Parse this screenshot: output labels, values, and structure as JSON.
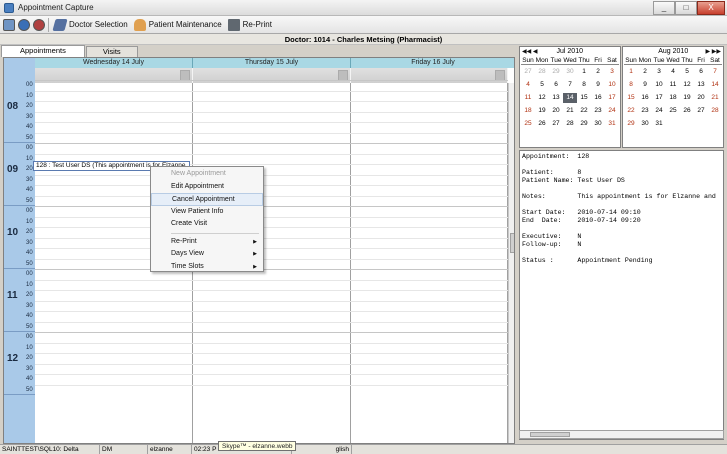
{
  "window": {
    "title": "Appointment Capture",
    "controls": [
      "_",
      "□",
      "X"
    ]
  },
  "toolbar": {
    "doctor_selection": "Doctor Selection",
    "patient_maintenance": "Patient Maintenance",
    "reprint": "Re-Print"
  },
  "header": {
    "title": "Doctor: 1014 - Charles Metsing (Pharmacist)"
  },
  "tabs": [
    {
      "label": "Appointments"
    },
    {
      "label": "Visits"
    }
  ],
  "calendar": {
    "days": [
      "Wednesday 14 July",
      "Thursday 15 July",
      "Friday 16 July"
    ],
    "hours": [
      "08",
      "09",
      "10",
      "11",
      "12"
    ],
    "minutes": [
      "00",
      "10",
      "20",
      "30",
      "40",
      "50"
    ]
  },
  "appointment": {
    "label": "128 : Test User DS (This appointment is for Elzanne"
  },
  "context_menu": {
    "new_appointment": "New Appointment",
    "edit_appointment": "Edit Appointment",
    "cancel_appointment": "Cancel Appointment",
    "view_patient_info": "View Patient Info",
    "create_visit": "Create Visit",
    "reprint": "Re-Print",
    "days_view": "Days View",
    "time_slots": "Time Slots"
  },
  "mini_calendars": {
    "dow": [
      "Sun",
      "Mon",
      "Tue",
      "Wed",
      "Thu",
      "Fri",
      "Sat"
    ],
    "jul": {
      "title": "Jul 2010",
      "selected": "14",
      "weeks": [
        [
          "27",
          "28",
          "29",
          "30",
          "1",
          "2",
          "3"
        ],
        [
          "4",
          "5",
          "6",
          "7",
          "8",
          "9",
          "10"
        ],
        [
          "11",
          "12",
          "13",
          "14",
          "15",
          "16",
          "17"
        ],
        [
          "18",
          "19",
          "20",
          "21",
          "22",
          "23",
          "24"
        ],
        [
          "25",
          "26",
          "27",
          "28",
          "29",
          "30",
          "31"
        ]
      ]
    },
    "aug": {
      "title": "Aug 2010",
      "weeks": [
        [
          "1",
          "2",
          "3",
          "4",
          "5",
          "6",
          "7"
        ],
        [
          "8",
          "9",
          "10",
          "11",
          "12",
          "13",
          "14"
        ],
        [
          "15",
          "16",
          "17",
          "18",
          "19",
          "20",
          "21"
        ],
        [
          "22",
          "23",
          "24",
          "25",
          "26",
          "27",
          "28"
        ],
        [
          "29",
          "30",
          "31",
          "",
          "",
          "",
          ""
        ]
      ]
    }
  },
  "details": {
    "appointment": "Appointment:  128",
    "patient": "Patient:      8",
    "patient_name": "Patient Name: Test User DS",
    "notes": "Notes:        This appointment is for Elzanne and",
    "start_date": "Start Date:   2010-07-14 09:10",
    "end_date": "End  Date:    2010-07-14 09:20",
    "executive": "Executive:    N",
    "followup": "Follow-up:    N",
    "status": "Status :      Appointment Pending"
  },
  "statusbar": {
    "server": "SAINTTEST\\SQL10: Delta",
    "code": "DM",
    "user": "elzanne",
    "time": "02:23 P",
    "lang": "glish"
  },
  "tooltip": {
    "text": "Skype™ - elzanne.webb"
  }
}
